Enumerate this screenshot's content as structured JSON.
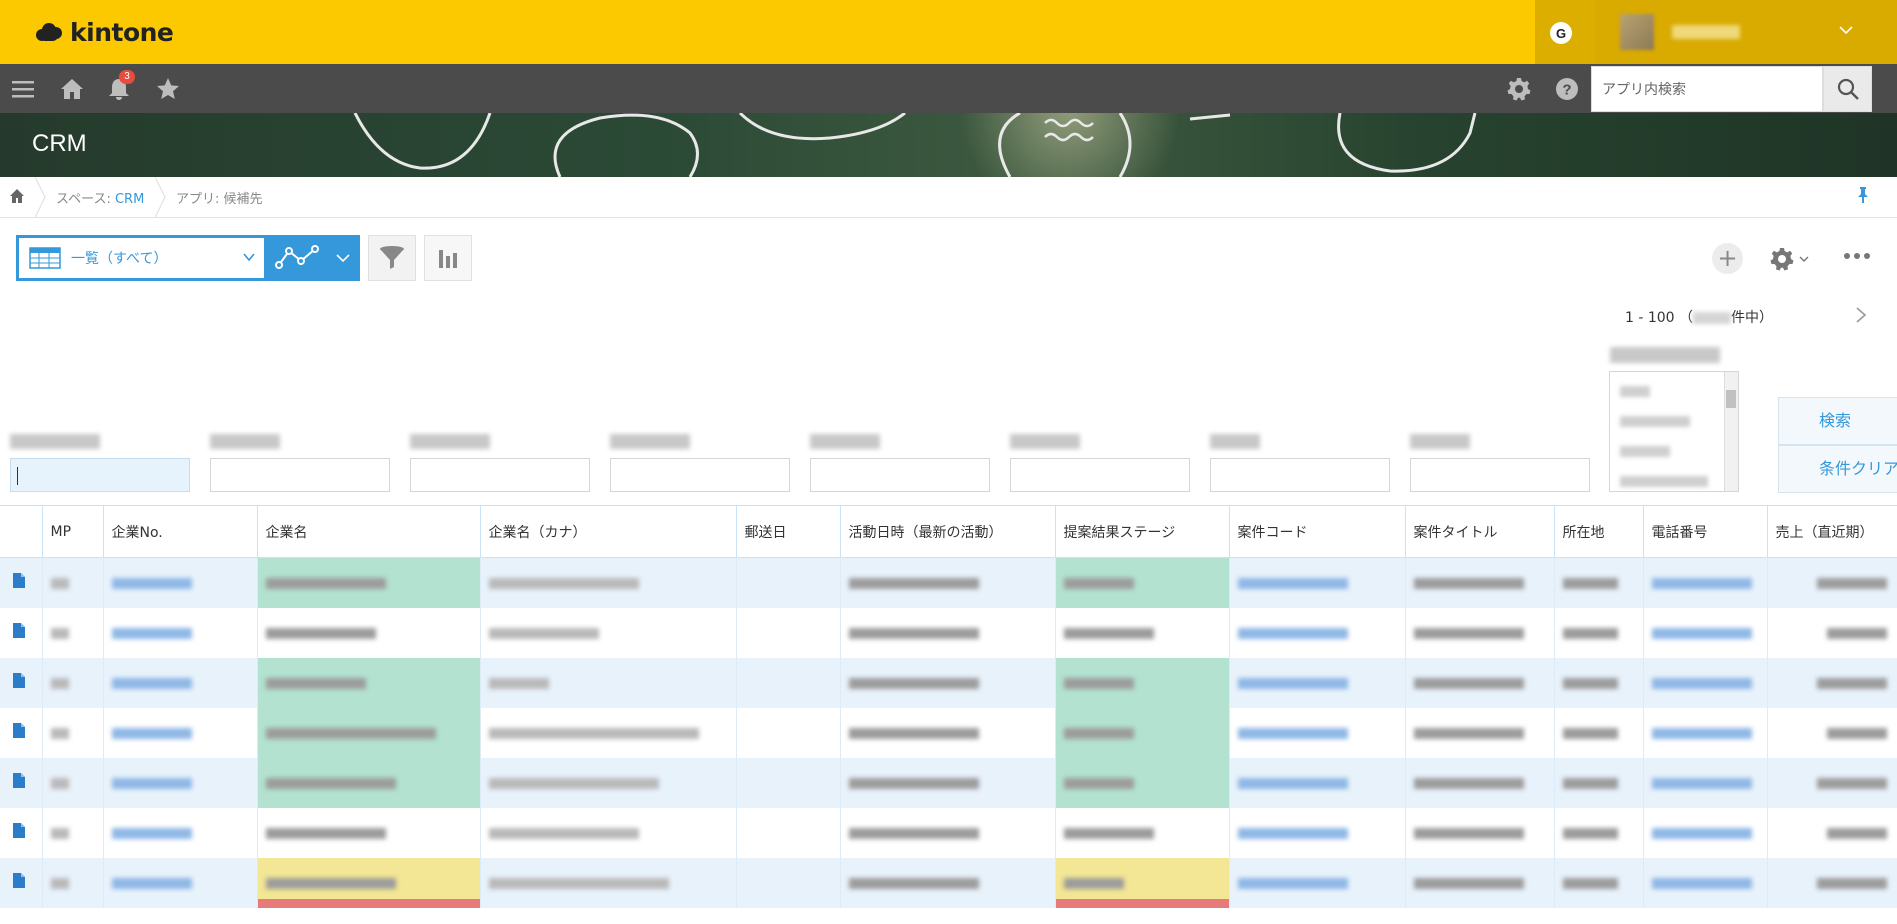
{
  "header": {
    "app_name": "kintone",
    "account_badge": "G",
    "notification_count": "3"
  },
  "navbar": {
    "search_placeholder": "アプリ内検索"
  },
  "banner": {
    "space_title": "CRM"
  },
  "breadcrumb": {
    "space_prefix": "スペース: ",
    "space_name": "CRM",
    "app_label": "アプリ: 候補先"
  },
  "view": {
    "selected_view": "一覧（すべて）"
  },
  "pager": {
    "range": "1 - 100 （",
    "suffix": "件中）"
  },
  "filter_buttons": {
    "search": "検索",
    "clear": "条件クリア"
  },
  "table": {
    "columns": [
      "",
      "MP",
      "企業No.",
      "企業名",
      "企業名（カナ）",
      "郵送日",
      "活動日時（最新の活動）",
      "提案結果ステージ",
      "案件コード",
      "案件タイトル",
      "所在地",
      "電話番号",
      "売上（直近期）"
    ],
    "rows": [
      {
        "company_highlight": "green",
        "stage_highlight": "green"
      },
      {
        "company_highlight": "none",
        "stage_highlight": "none"
      },
      {
        "company_highlight": "green",
        "stage_highlight": "green"
      },
      {
        "company_highlight": "green",
        "stage_highlight": "green"
      },
      {
        "company_highlight": "green",
        "stage_highlight": "green"
      },
      {
        "company_highlight": "none",
        "stage_highlight": "none"
      },
      {
        "company_highlight": "yellow",
        "stage_highlight": "yellow"
      }
    ]
  },
  "colors": {
    "header_yellow": "#fcc800",
    "navbar_gray": "#4b4b4b",
    "accent_blue": "#3498db",
    "highlight_green": "#b3e2d0",
    "highlight_yellow": "#f3e694",
    "highlight_red": "#e77b7b"
  }
}
